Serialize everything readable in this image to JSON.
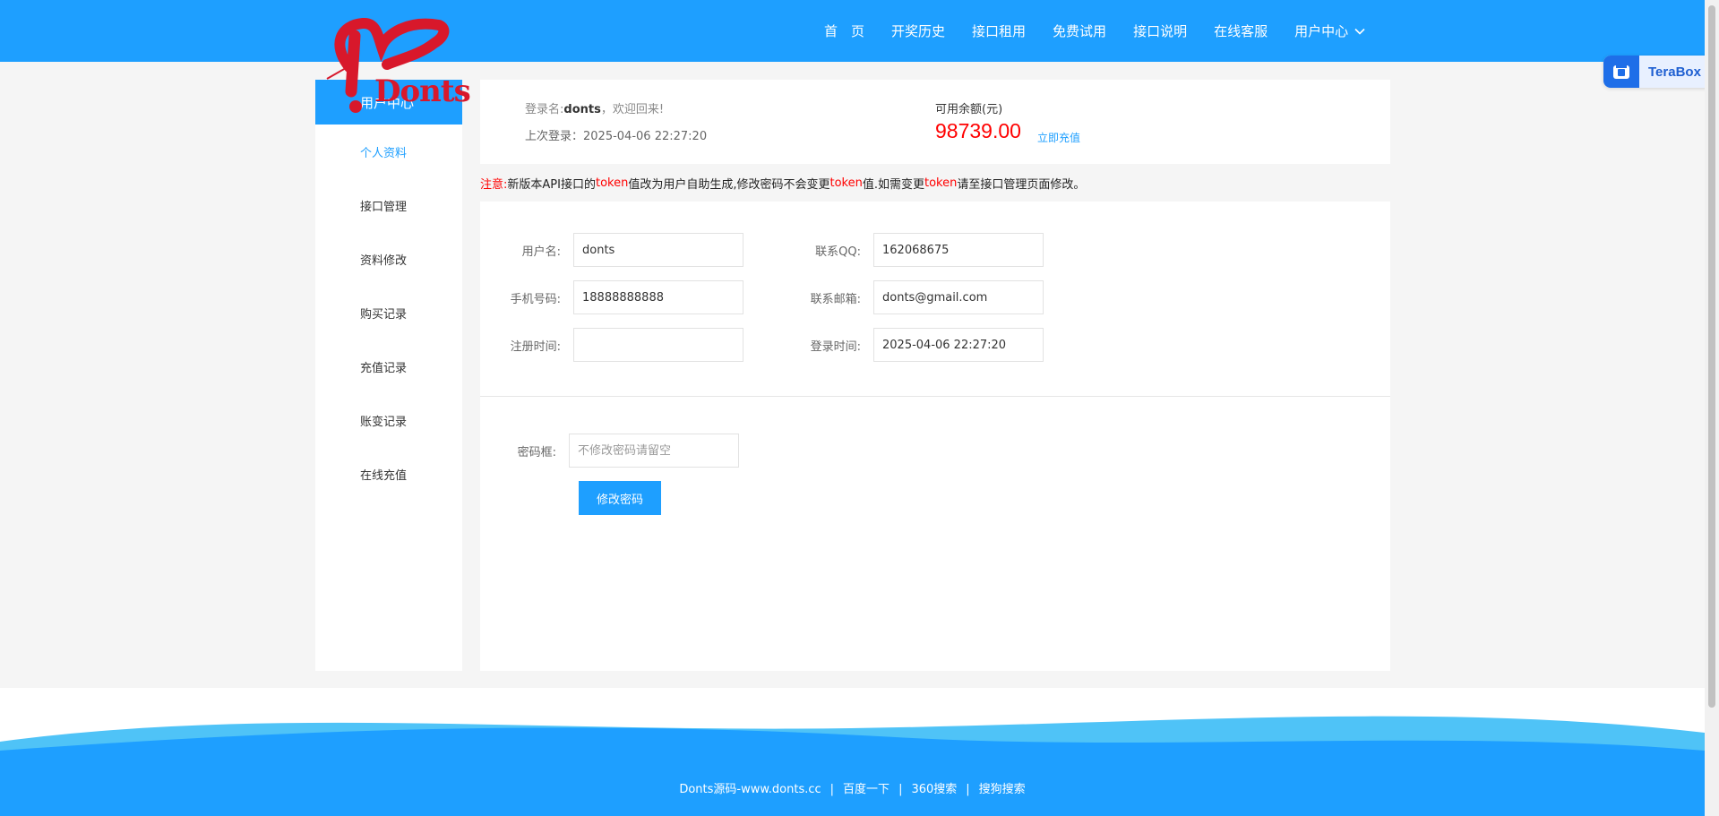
{
  "logo": {
    "text": "Donts"
  },
  "nav": {
    "items": [
      "首　页",
      "开奖历史",
      "接口租用",
      "免费试用",
      "接口说明",
      "在线客服",
      "用户中心"
    ]
  },
  "terabox": {
    "label": "TeraBox"
  },
  "sidebar": {
    "title": "用户中心",
    "items": [
      "个人资料",
      "接口管理",
      "资料修改",
      "购买记录",
      "充值记录",
      "账变记录",
      "在线充值"
    ]
  },
  "account": {
    "login_prefix": "登录名:",
    "username": "donts",
    "welcome": "，欢迎回来!",
    "last_login_label": "上次登录：",
    "last_login": "2025-04-06 22:27:20",
    "balance_label": "可用余额(元)",
    "balance": "98739.00",
    "recharge_link": "立即充值"
  },
  "notice": {
    "prefix": "注意:",
    "part1": " 新版本API接口的",
    "token1": "token",
    "part2": "值改为用户自助生成,修改密码不会变更",
    "token2": "token",
    "part3": "值.如需变更",
    "token3": "token",
    "part4": "请至接口管理页面修改。"
  },
  "form": {
    "username_label": "用户名:",
    "username_value": "donts",
    "qq_label": "联系QQ:",
    "qq_value": "162068675",
    "phone_label": "手机号码:",
    "phone_value": "18888888888",
    "email_label": "联系邮箱:",
    "email_value": "donts@gmail.com",
    "reg_time_label": "注册时间:",
    "reg_time_value": "",
    "login_time_label": "登录时间:",
    "login_time_value": "2025-04-06 22:27:20",
    "password_label": "密码框:",
    "password_placeholder": "不修改密码请留空",
    "submit_label": "修改密码"
  },
  "footer": {
    "links": [
      "Donts源码-www.donts.cc",
      "百度一下",
      "360搜索",
      "搜狗搜索"
    ],
    "separator": "|"
  },
  "colors": {
    "primary": "#1e9fff",
    "alert": "#ff0000",
    "logo": "#d8182b"
  }
}
